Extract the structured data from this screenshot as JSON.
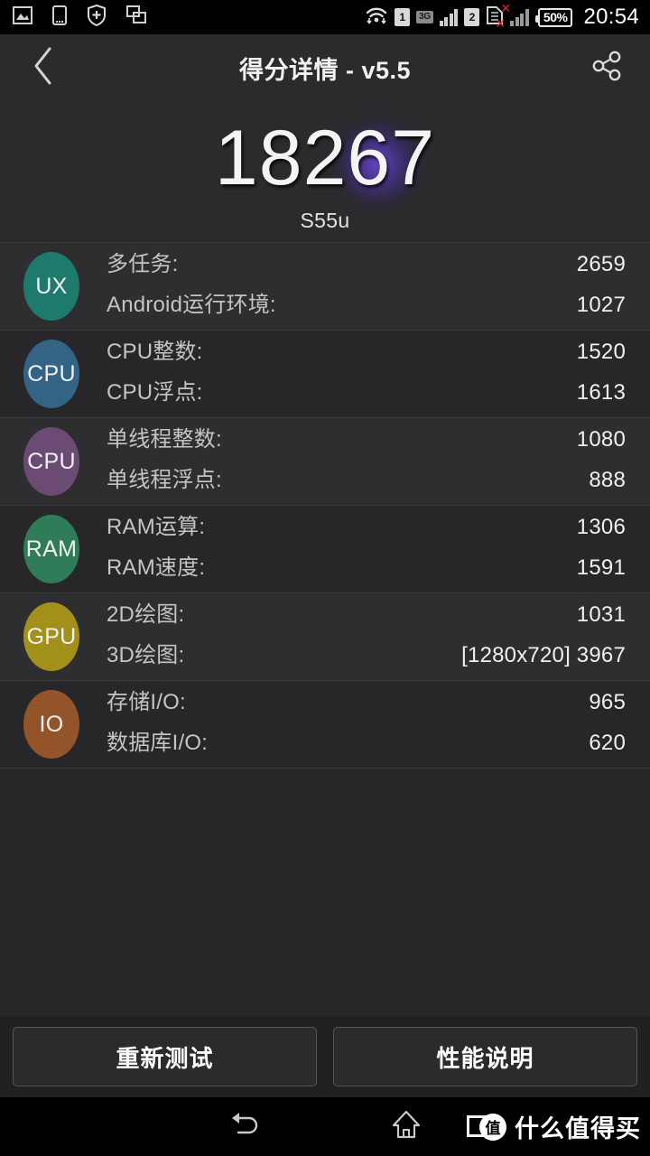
{
  "statusbar": {
    "left_icons": [
      "photo-icon",
      "sdcard-icon",
      "shield-plus-icon",
      "windows-icon"
    ],
    "wifi_icon": "wifi-icon",
    "sim1_label": "1",
    "network_type": "3G",
    "sim2_label": "2",
    "battery_percent": "50%",
    "time": "20:54"
  },
  "header": {
    "back_icon": "chevron-left-icon",
    "title": "得分详情 - v5.5",
    "share_icon": "share-icon"
  },
  "score": {
    "total": "18267",
    "device": "S55u"
  },
  "results": [
    {
      "badge": "UX",
      "badge_color": "#1f7a6e",
      "metrics": [
        {
          "label": "多任务:",
          "value": "2659"
        },
        {
          "label": "Android运行环境:",
          "value": "1027"
        }
      ]
    },
    {
      "badge": "CPU",
      "badge_color": "#336485",
      "metrics": [
        {
          "label": "CPU整数:",
          "value": "1520"
        },
        {
          "label": "CPU浮点:",
          "value": "1613"
        }
      ]
    },
    {
      "badge": "CPU",
      "badge_color": "#6b4a74",
      "metrics": [
        {
          "label": "单线程整数:",
          "value": "1080"
        },
        {
          "label": "单线程浮点:",
          "value": "888"
        }
      ]
    },
    {
      "badge": "RAM",
      "badge_color": "#2e7d58",
      "metrics": [
        {
          "label": "RAM运算:",
          "value": "1306"
        },
        {
          "label": "RAM速度:",
          "value": "1591"
        }
      ]
    },
    {
      "badge": "GPU",
      "badge_color": "#a2901b",
      "metrics": [
        {
          "label": "2D绘图:",
          "value": "1031"
        },
        {
          "label": "3D绘图:",
          "value": "[1280x720] 3967"
        }
      ]
    },
    {
      "badge": "IO",
      "badge_color": "#94542a",
      "metrics": [
        {
          "label": "存储I/O:",
          "value": "965"
        },
        {
          "label": "数据库I/O:",
          "value": "620"
        }
      ]
    }
  ],
  "buttons": {
    "retest": "重新测试",
    "explain": "性能说明"
  },
  "navbar": {
    "back_icon": "nav-back-icon",
    "home_icon": "nav-home-icon",
    "watermark_mark": "值",
    "watermark_text": "什么值得买"
  }
}
